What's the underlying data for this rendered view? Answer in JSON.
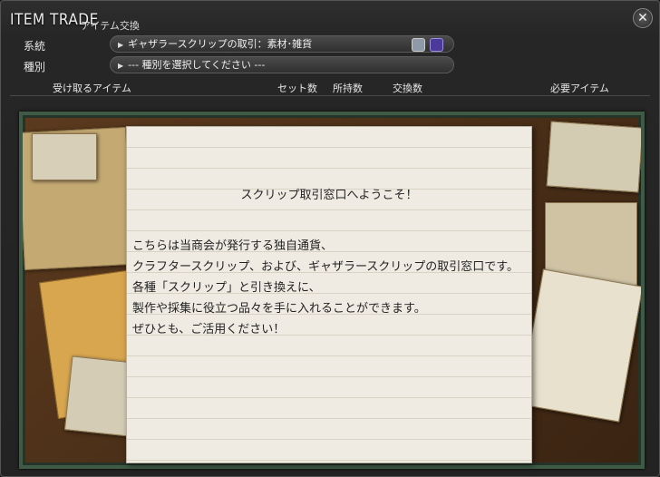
{
  "window": {
    "title": "ITEM TRADE",
    "subtitle": "アイテム交換",
    "close_glyph": "✕"
  },
  "filters": {
    "category_label": "系統",
    "category_value": "ギャザラースクリップの取引：素材･雑貨",
    "type_label": "種別",
    "type_value": "--- 種別を選択してください ---"
  },
  "columns": {
    "receive": "受け取るアイテム",
    "set_count": "セット数",
    "owned": "所持数",
    "exchange_count": "交換数",
    "required": "必要アイテム"
  },
  "welcome": {
    "title": "スクリップ取引窓口へようこそ！",
    "lines": [
      "こちらは当商会が発行する独自通貨、",
      "クラフタースクリップ、および、ギャザラースクリップの取引窓口です。",
      "各種「スクリップ」と引き換えに、",
      "製作や採集に役立つ品々を手に入れることができます。",
      "ぜひとも、ご活用ください！"
    ]
  },
  "icons": {
    "arrow": "▶",
    "dropdown_icon_1": "armor-icon",
    "dropdown_icon_2": "scrip-icon"
  },
  "colors": {
    "board_frame": "#3e5b46",
    "note_paper": "#efebe2"
  }
}
